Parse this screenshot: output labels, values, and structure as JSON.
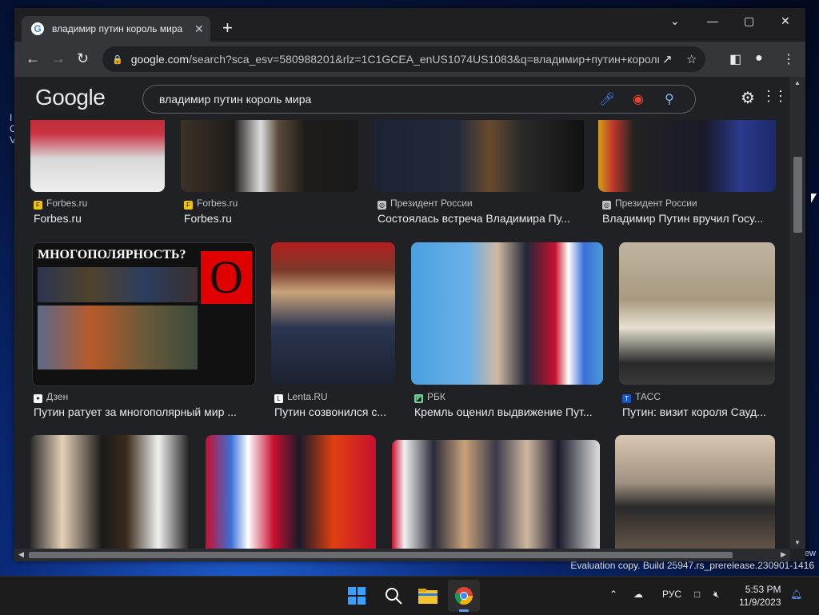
{
  "desktop": {
    "left_text": "I\nC\nV",
    "right_text": "ew",
    "watermark": "Evaluation copy. Build 25947.rs_prerelease.230901-1416"
  },
  "browser": {
    "tab_title": "владимир путин король мира",
    "tab_close": "✕",
    "new_tab": "+",
    "url_host": "google.com",
    "url_rest": "/search?sca_esv=580988201&rlz=1C1GCEA_enUS1074US1083&q=владимир+путин+король...",
    "window_controls": [
      "⌄",
      "—",
      "▢",
      "✕"
    ]
  },
  "google": {
    "logo": "Google",
    "query": "владимир путин король мира"
  },
  "results": {
    "row1": [
      {
        "source": "Forbes.ru",
        "caption": "Forbes.ru",
        "icon_color": "#f1c40f",
        "icon": "F"
      },
      {
        "source": "Forbes.ru",
        "caption": "Forbes.ru",
        "icon_color": "#f1c40f",
        "icon": "F"
      },
      {
        "source": "Президент России",
        "caption": "Состоялась встреча Владимира Пу...",
        "icon_color": "#bdc1c6",
        "icon": "◎"
      },
      {
        "source": "Президент России",
        "caption": "Владимир Путин вручил Госу...",
        "icon_color": "#bdc1c6",
        "icon": "◎"
      }
    ],
    "row2": [
      {
        "source": "Дзен",
        "caption": "Путин ратует за многополярный мир ...",
        "icon_color": "#ffffff",
        "icon": "✦"
      },
      {
        "source": "Lenta.RU",
        "caption": "Путин созвонился с...",
        "icon_color": "#ffffff",
        "icon": "L"
      },
      {
        "source": "РБК",
        "caption": "Кремль оценил выдвижение Пут...",
        "icon_color": "#6fcf97",
        "icon": "◪"
      },
      {
        "source": "ТАСС",
        "caption": "Путин: визит короля Сауд...",
        "icon_color": "#1a56c9",
        "icon": "T"
      }
    ],
    "poster_title": "МНОГОПОЛЯРНОСТЬ?",
    "poster_logo": "O"
  },
  "taskbar": {
    "lang": "РУС",
    "time": "5:53 PM",
    "date": "11/9/2023"
  }
}
